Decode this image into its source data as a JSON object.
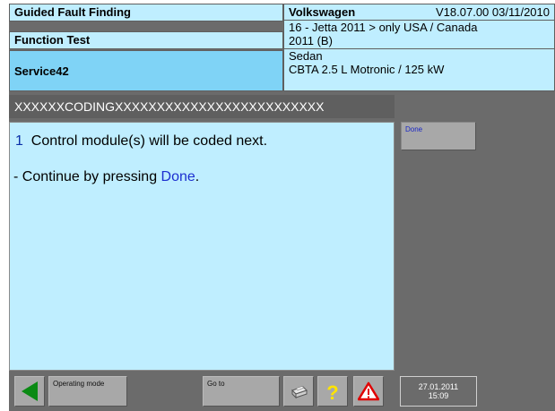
{
  "header": {
    "mode": "Guided Fault Finding",
    "function": "Function Test",
    "service": "Service42",
    "brand": "Volkswagen",
    "version": "V18.07.00 03/11/2010",
    "model_line1": "16 - Jetta 2011 > only USA / Canada",
    "model_line2": "2011 (B)",
    "body": "Sedan",
    "engine": "CBTA 2.5 L Motronic / 125 kW"
  },
  "title_bar": "XXXXXXCODINGXXXXXXXXXXXXXXXXXXXXXXXXX",
  "main": {
    "step_number": "1",
    "line1": "Control module(s) will be coded next.",
    "line2_prefix": "- Continue by pressing ",
    "line2_link": "Done",
    "line2_suffix": "."
  },
  "right_panel": {
    "done_label": "Done"
  },
  "toolbar": {
    "operating_mode_label": "Operating mode",
    "goto_label": "Go to",
    "date": "27.01.2011",
    "time": "15:09"
  },
  "icons": {
    "back": "back-arrow-icon",
    "print": "printer-icon",
    "help": "help-icon",
    "warning": "warning-icon"
  },
  "colors": {
    "panel": "#bfeeff",
    "selected": "#7fd3f6",
    "background": "#6b6b6b",
    "link": "#1c2fd0",
    "help": "#ffe400",
    "warning": "#e00000",
    "back_arrow": "#0b8a14"
  }
}
